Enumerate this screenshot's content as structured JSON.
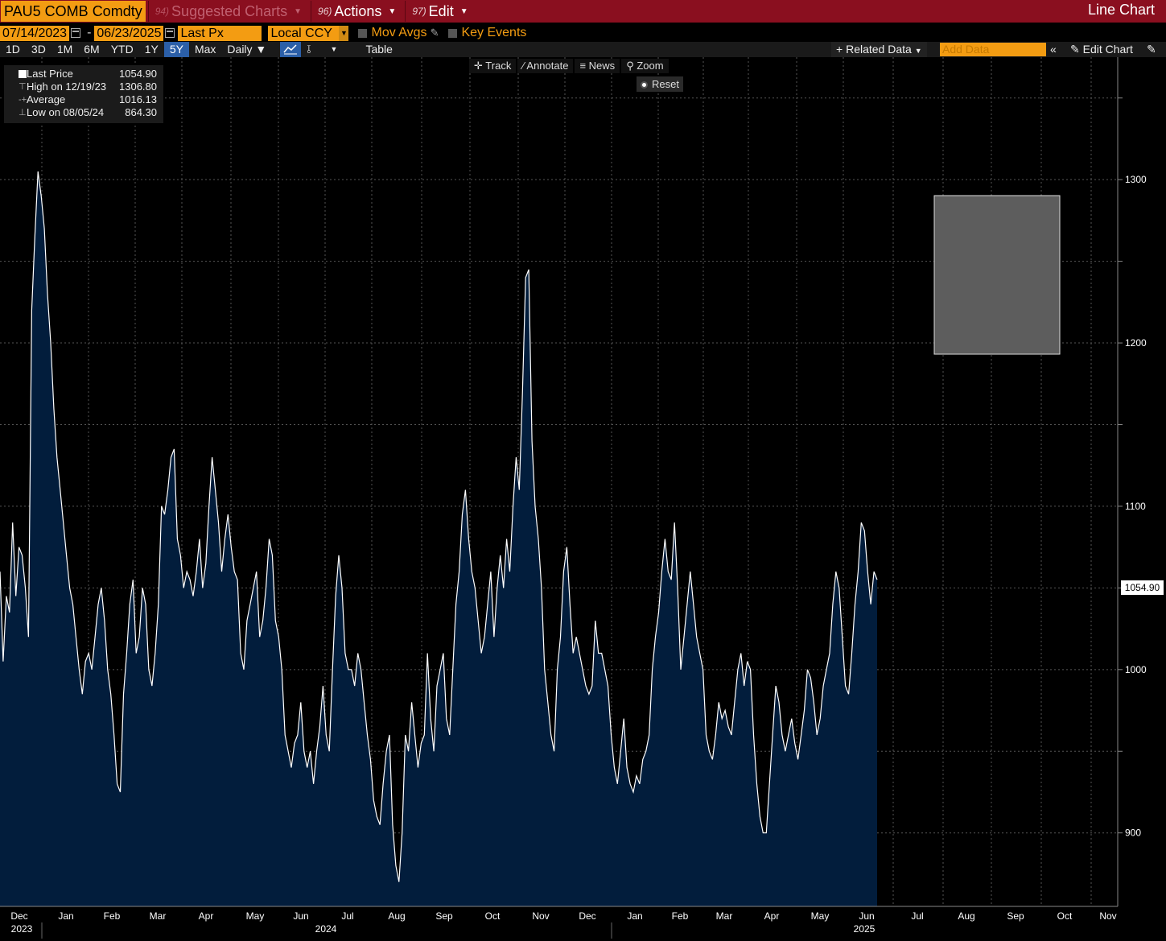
{
  "topbar": {
    "ticker": "PAU5 COMB Comdty",
    "suggested": {
      "num": "94)",
      "label": "Suggested Charts"
    },
    "actions": {
      "num": "96)",
      "label": "Actions"
    },
    "edit": {
      "num": "97)",
      "label": "Edit"
    },
    "view_title": "Line Chart"
  },
  "controls": {
    "start_date": "07/14/2023",
    "end_date": "06/23/2025",
    "field": "Last Px",
    "currency": "Local CCY",
    "mov_avgs": "Mov Avgs",
    "key_events": "Key Events"
  },
  "ranges": [
    "1D",
    "3D",
    "1M",
    "6M",
    "YTD",
    "1Y",
    "5Y",
    "Max"
  ],
  "active_range": "5Y",
  "frequency": "Daily",
  "table_label": "Table",
  "related_data": "Related Data",
  "add_data_placeholder": "Add Data",
  "edit_chart": "Edit Chart",
  "chart_tools": {
    "track": "Track",
    "annotate": "Annotate",
    "news": "News",
    "zoom": "Zoom",
    "reset": "Reset"
  },
  "legend": {
    "last_label": "Last Price",
    "last_value": "1054.90",
    "high_label": "High on 12/19/23",
    "high_value": "1306.80",
    "avg_label": "Average",
    "avg_value": "1016.13",
    "low_label": "Low on 08/05/24",
    "low_value": "864.30"
  },
  "colors": {
    "fill": "#021d3c",
    "line": "#ffffff",
    "topbar": "#8a0f1f",
    "accent": "#f39c12"
  },
  "chart_data": {
    "type": "area",
    "y_ticks": [
      900,
      1000,
      1100,
      1200,
      1300
    ],
    "ylim": [
      855,
      1375
    ],
    "last_price_label": "1054.90",
    "x_month_labels": [
      "Dec",
      "Jan",
      "Feb",
      "Mar",
      "Apr",
      "May",
      "Jun",
      "Jul",
      "Aug",
      "Sep",
      "Oct",
      "Nov",
      "Dec",
      "Jan",
      "Feb",
      "Mar",
      "Apr",
      "May",
      "Jun",
      "Jul",
      "Aug",
      "Sep",
      "Oct",
      "Nov"
    ],
    "x_year_labels": [
      "2023",
      "2024",
      "2025"
    ],
    "series": [
      {
        "values": [
          1060,
          1005,
          1045,
          1035,
          1090,
          1045,
          1075,
          1070,
          1050,
          1020,
          1220,
          1265,
          1305,
          1290,
          1270,
          1230,
          1200,
          1160,
          1130,
          1110,
          1090,
          1070,
          1050,
          1040,
          1020,
          1000,
          985,
          1005,
          1010,
          1000,
          1020,
          1040,
          1050,
          1030,
          1000,
          985,
          960,
          930,
          925,
          985,
          1010,
          1040,
          1055,
          1010,
          1020,
          1050,
          1040,
          1000,
          990,
          1010,
          1040,
          1100,
          1095,
          1110,
          1130,
          1135,
          1080,
          1070,
          1050,
          1060,
          1055,
          1045,
          1060,
          1080,
          1050,
          1065,
          1100,
          1130,
          1110,
          1090,
          1060,
          1080,
          1095,
          1075,
          1060,
          1055,
          1010,
          1000,
          1030,
          1040,
          1050,
          1060,
          1020,
          1030,
          1050,
          1080,
          1070,
          1030,
          1020,
          1000,
          960,
          950,
          940,
          955,
          960,
          980,
          950,
          940,
          950,
          930,
          950,
          965,
          990,
          960,
          950,
          1000,
          1045,
          1070,
          1050,
          1010,
          1000,
          1000,
          990,
          1010,
          1000,
          980,
          960,
          945,
          920,
          910,
          905,
          930,
          950,
          960,
          905,
          880,
          870,
          900,
          960,
          950,
          980,
          960,
          940,
          955,
          960,
          1010,
          970,
          950,
          990,
          1000,
          1010,
          970,
          960,
          1000,
          1040,
          1060,
          1095,
          1110,
          1080,
          1060,
          1050,
          1030,
          1010,
          1020,
          1040,
          1060,
          1020,
          1050,
          1070,
          1050,
          1080,
          1060,
          1100,
          1130,
          1110,
          1170,
          1240,
          1245,
          1140,
          1100,
          1080,
          1050,
          1000,
          980,
          960,
          950,
          1000,
          1020,
          1060,
          1075,
          1040,
          1010,
          1020,
          1010,
          1000,
          990,
          985,
          990,
          1030,
          1010,
          1010,
          1000,
          990,
          960,
          940,
          930,
          950,
          970,
          940,
          930,
          925,
          935,
          930,
          945,
          950,
          960,
          1000,
          1020,
          1035,
          1060,
          1080,
          1060,
          1055,
          1090,
          1050,
          1000,
          1020,
          1040,
          1060,
          1040,
          1020,
          1010,
          1000,
          960,
          950,
          945,
          960,
          980,
          970,
          975,
          965,
          960,
          980,
          1000,
          1010,
          990,
          1005,
          1000,
          960,
          930,
          910,
          900,
          900,
          930,
          960,
          990,
          980,
          960,
          950,
          960,
          970,
          955,
          945,
          960,
          975,
          1000,
          995,
          980,
          960,
          970,
          990,
          1000,
          1010,
          1040,
          1060,
          1050,
          1020,
          990,
          985,
          1010,
          1040,
          1060,
          1090,
          1085,
          1060,
          1040,
          1060,
          1055
        ]
      }
    ]
  }
}
